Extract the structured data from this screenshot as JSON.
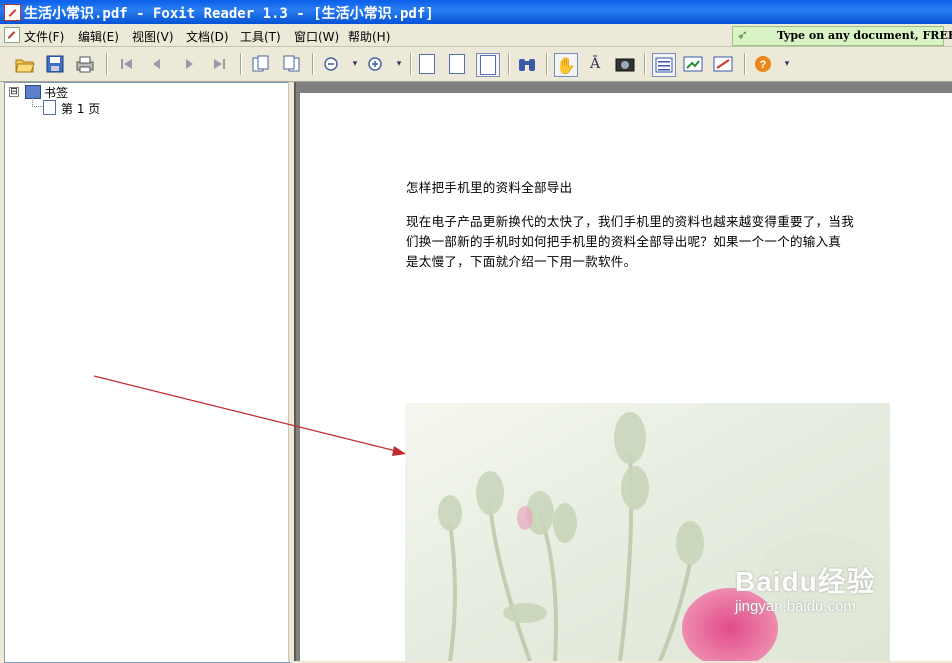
{
  "window": {
    "title": "生活小常识.pdf - Foxit Reader 1.3 - [生活小常识.pdf]"
  },
  "menu": {
    "items": [
      {
        "label": "文件(F)"
      },
      {
        "label": "编辑(E)"
      },
      {
        "label": "视图(V)"
      },
      {
        "label": "文档(D)"
      },
      {
        "label": "工具(T)"
      },
      {
        "label": "窗口(W)"
      },
      {
        "label": "帮助(H)"
      }
    ],
    "ad_text": "Type on any document, FREE!"
  },
  "bookmarks": {
    "root_label": "书签",
    "expander": "⊟",
    "children": [
      {
        "label": "第 1 页"
      }
    ]
  },
  "document": {
    "heading": "怎样把手机里的资料全部导出",
    "paragraph_lines": [
      "现在电子产品更新换代的太快了，我们手机里的资料也越来越变得重要了，当我",
      "们换一部新的手机时如何把手机里的资料全部导出呢？如果一个一个的输入真",
      "是太慢了，下面就介绍一下用一款软件。"
    ]
  },
  "watermark": {
    "brand": "Baidu经验",
    "url": "jingyan.baidu.com"
  },
  "icons": {
    "open": "folder-open-icon",
    "save": "save-icon",
    "print": "print-icon",
    "first": "first-page-icon",
    "prev": "prev-page-icon",
    "next": "next-page-icon",
    "last": "last-page-icon",
    "zoom_out": "zoom-out-icon",
    "zoom_in": "zoom-in-icon",
    "find": "binoculars-icon",
    "hand": "hand-tool-icon",
    "text_select": "text-select-icon",
    "snapshot": "snapshot-icon",
    "help": "help-icon"
  },
  "colors": {
    "titlebar": "#0a5ee8",
    "ad_background": "#d9f3c6",
    "annotation_arrow": "#c0282d"
  }
}
